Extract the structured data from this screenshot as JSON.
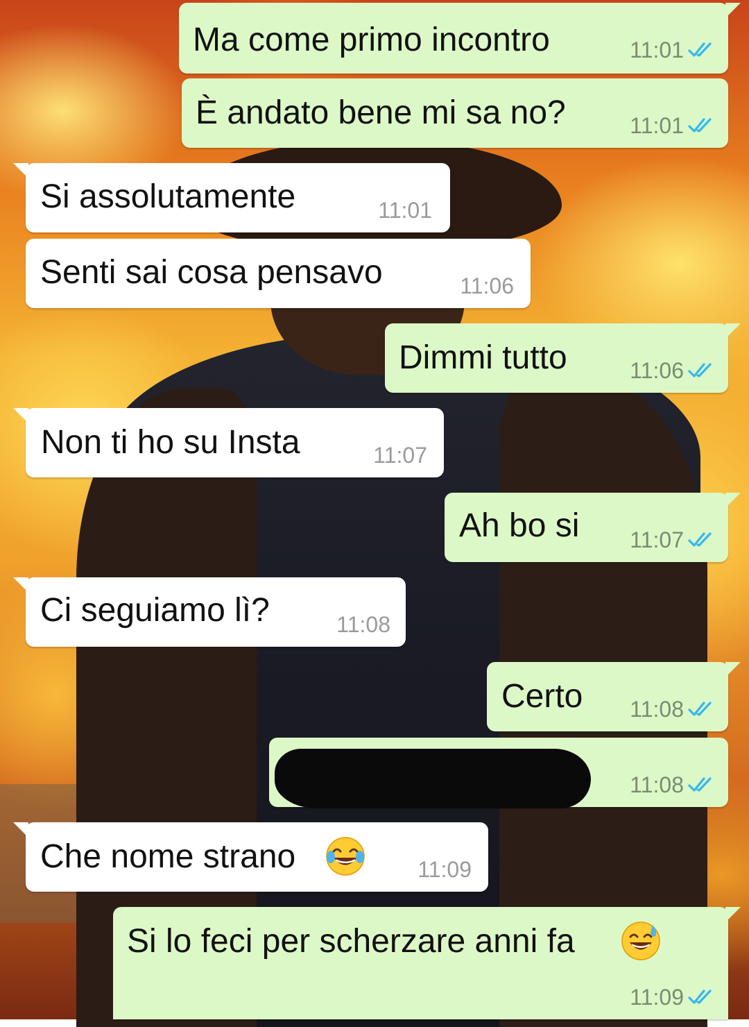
{
  "app": {
    "accent_out_bubble": "#dcf8c6",
    "accent_in_bubble": "#ffffff",
    "read_tick_color": "#34b7f1"
  },
  "messages": [
    {
      "direction": "out",
      "text": "Ma come primo incontro",
      "time": "11:01",
      "status": "read"
    },
    {
      "direction": "out",
      "text": "È andato bene mi sa no?",
      "time": "11:01",
      "status": "read"
    },
    {
      "direction": "in",
      "text": "Si assolutamente",
      "time": "11:01"
    },
    {
      "direction": "in",
      "text": "Senti sai cosa pensavo",
      "time": "11:06"
    },
    {
      "direction": "out",
      "text": "Dimmi tutto",
      "time": "11:06",
      "status": "read"
    },
    {
      "direction": "in",
      "text": "Non ti ho su Insta",
      "time": "11:07"
    },
    {
      "direction": "out",
      "text": "Ah bo si",
      "time": "11:07",
      "status": "read"
    },
    {
      "direction": "in",
      "text": "Ci seguiamo lì?",
      "time": "11:08"
    },
    {
      "direction": "out",
      "text": "Certo",
      "time": "11:08",
      "status": "read"
    },
    {
      "direction": "out",
      "text": "",
      "redacted": true,
      "time": "11:08",
      "status": "read"
    },
    {
      "direction": "in",
      "text": "Che nome strano",
      "emoji": "face-with-tears-of-joy-icon",
      "time": "11:09"
    },
    {
      "direction": "out",
      "text": "Si lo feci per scherzare anni fa",
      "emoji": "grinning-face-with-sweat-icon",
      "time": "11:09",
      "status": "read"
    }
  ]
}
